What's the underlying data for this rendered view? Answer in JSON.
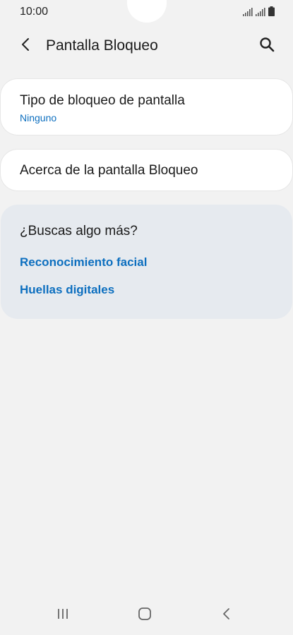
{
  "status_bar": {
    "time": "10:00",
    "icons": [
      "signal-icon",
      "signal-icon",
      "battery-icon"
    ]
  },
  "header": {
    "title": "Pantalla Bloqueo",
    "back_icon": "back-arrow-icon",
    "search_icon": "search-icon"
  },
  "settings": {
    "lock_type": {
      "title": "Tipo de bloqueo de pantalla",
      "value": "Ninguno"
    },
    "about": {
      "title": "Acerca de la pantalla Bloqueo"
    }
  },
  "suggestions": {
    "heading": "¿Buscas algo más?",
    "links": [
      "Reconocimiento facial",
      "Huellas digitales"
    ]
  },
  "nav_bar": {
    "buttons": [
      "recents-icon",
      "home-icon",
      "back-icon"
    ]
  },
  "colors": {
    "background": "#f2f2f2",
    "card": "#ffffff",
    "accent": "#0d6fbf",
    "suggest_bg": "#e6eaef"
  }
}
